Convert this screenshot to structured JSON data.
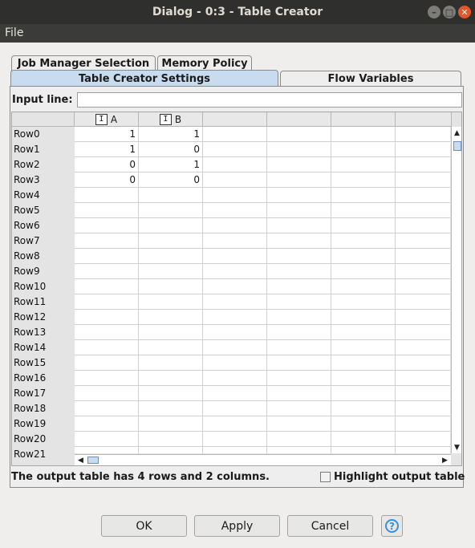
{
  "window": {
    "title": "Dialog - 0:3 - Table Creator"
  },
  "menu": {
    "file": "File"
  },
  "tabs": {
    "row1": [
      "Job Manager Selection",
      "Memory Policy"
    ],
    "row2": [
      "Table Creator Settings",
      "Flow Variables"
    ],
    "active": "Table Creator Settings"
  },
  "input": {
    "label": "Input line:",
    "value": ""
  },
  "table": {
    "columns": [
      {
        "type": "I",
        "name": "A"
      },
      {
        "type": "I",
        "name": "B"
      },
      {
        "type": "",
        "name": ""
      },
      {
        "type": "",
        "name": ""
      },
      {
        "type": "",
        "name": ""
      },
      {
        "type": "",
        "name": ""
      }
    ],
    "rows": [
      {
        "label": "Row0",
        "values": [
          "1",
          "1"
        ]
      },
      {
        "label": "Row1",
        "values": [
          "1",
          "0"
        ]
      },
      {
        "label": "Row2",
        "values": [
          "0",
          "1"
        ]
      },
      {
        "label": "Row3",
        "values": [
          "0",
          "0"
        ]
      },
      {
        "label": "Row4",
        "values": []
      },
      {
        "label": "Row5",
        "values": []
      },
      {
        "label": "Row6",
        "values": []
      },
      {
        "label": "Row7",
        "values": []
      },
      {
        "label": "Row8",
        "values": []
      },
      {
        "label": "Row9",
        "values": []
      },
      {
        "label": "Row10",
        "values": []
      },
      {
        "label": "Row11",
        "values": []
      },
      {
        "label": "Row12",
        "values": []
      },
      {
        "label": "Row13",
        "values": []
      },
      {
        "label": "Row14",
        "values": []
      },
      {
        "label": "Row15",
        "values": []
      },
      {
        "label": "Row16",
        "values": []
      },
      {
        "label": "Row17",
        "values": []
      },
      {
        "label": "Row18",
        "values": []
      },
      {
        "label": "Row19",
        "values": []
      },
      {
        "label": "Row20",
        "values": []
      },
      {
        "label": "Row21",
        "values": []
      }
    ]
  },
  "status": {
    "text": "The output table has 4 rows and 2 columns."
  },
  "highlight": {
    "label": "Highlight output table",
    "checked": false
  },
  "buttons": {
    "ok": "OK",
    "apply": "Apply",
    "cancel": "Cancel",
    "help": "?"
  }
}
